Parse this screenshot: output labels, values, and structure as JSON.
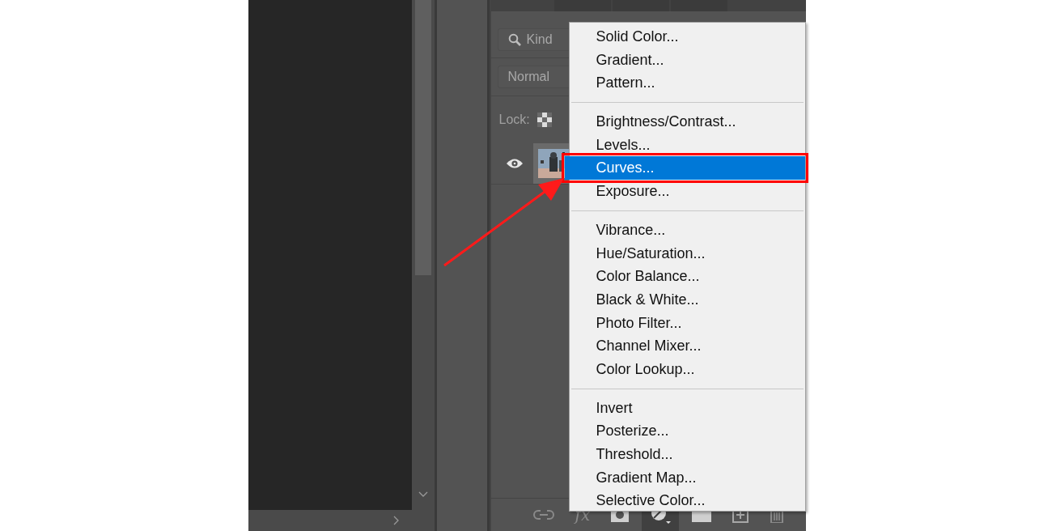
{
  "layers_panel": {
    "filter": {
      "placeholder": "Kind"
    },
    "blend_mode": "Normal",
    "lock_label": "Lock:",
    "layers": [
      {
        "visible": true,
        "kind": "picture"
      }
    ],
    "toolbar": [
      {
        "kind": "link"
      },
      {
        "kind": "fx",
        "label": "fx"
      },
      {
        "kind": "mask"
      },
      {
        "kind": "adjustment",
        "selected": true
      },
      {
        "kind": "folder"
      },
      {
        "kind": "new"
      },
      {
        "kind": "trash"
      }
    ]
  },
  "adjustment_menu": {
    "groups": [
      {
        "items": [
          {
            "label": "Solid Color...",
            "selected": false
          },
          {
            "label": "Gradient...",
            "selected": false
          },
          {
            "label": "Pattern...",
            "selected": false
          }
        ]
      },
      {
        "items": [
          {
            "label": "Brightness/Contrast...",
            "selected": false
          },
          {
            "label": "Levels...",
            "selected": false
          },
          {
            "label": "Curves...",
            "selected": true
          },
          {
            "label": "Exposure...",
            "selected": false
          }
        ]
      },
      {
        "items": [
          {
            "label": "Vibrance...",
            "selected": false
          },
          {
            "label": "Hue/Saturation...",
            "selected": false
          },
          {
            "label": "Color Balance...",
            "selected": false
          },
          {
            "label": "Black & White...",
            "selected": false
          },
          {
            "label": "Photo Filter...",
            "selected": false
          },
          {
            "label": "Channel Mixer...",
            "selected": false
          },
          {
            "label": "Color Lookup...",
            "selected": false
          }
        ]
      },
      {
        "items": [
          {
            "label": "Invert",
            "selected": false
          },
          {
            "label": "Posterize...",
            "selected": false
          },
          {
            "label": "Threshold...",
            "selected": false
          },
          {
            "label": "Gradient Map...",
            "selected": false
          },
          {
            "label": "Selective Color...",
            "selected": false
          }
        ]
      }
    ]
  }
}
